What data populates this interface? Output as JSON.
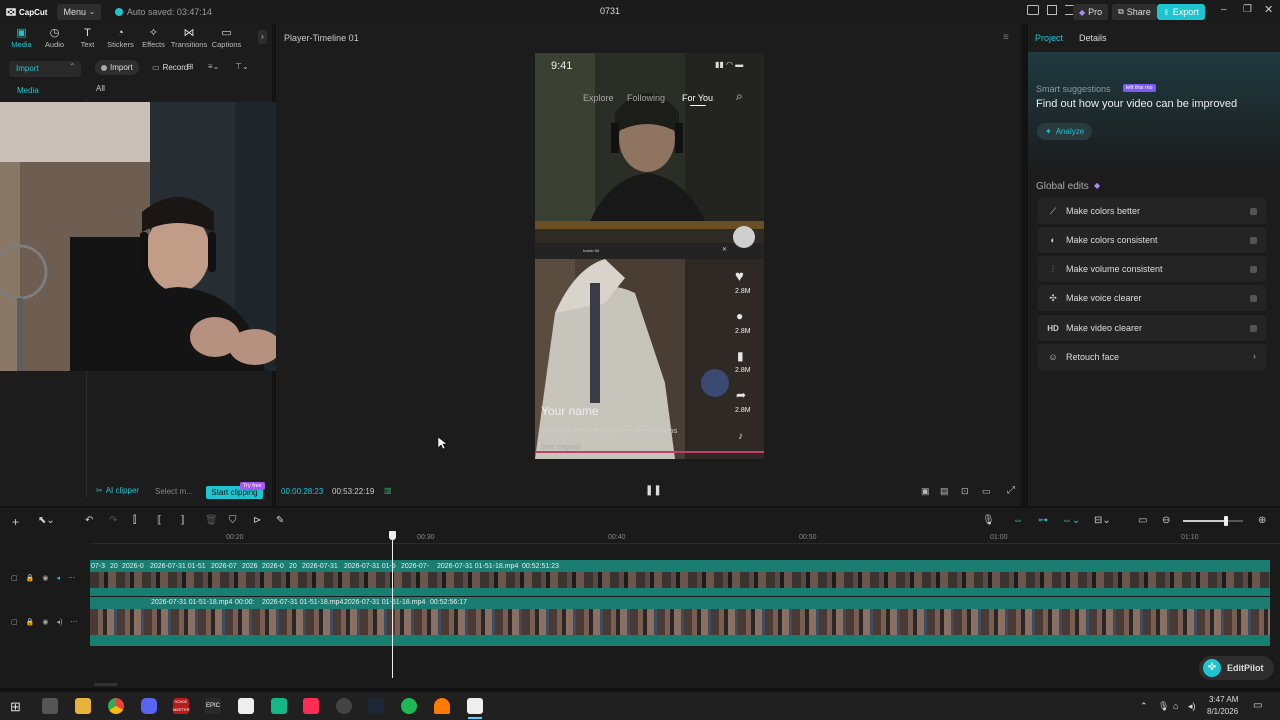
{
  "titlebar": {
    "app_name": "CapCut",
    "menu_label": "Menu",
    "autosave": "Auto saved: 03:47:14",
    "project_title": "0731",
    "pro_label": "Pro",
    "share_label": "Share",
    "export_label": "Export"
  },
  "left": {
    "tabs": [
      {
        "label": "Media",
        "icon": "media-icon"
      },
      {
        "label": "Audio",
        "icon": "audio-icon"
      },
      {
        "label": "Text",
        "icon": "text-icon"
      },
      {
        "label": "Stickers",
        "icon": "stickers-icon"
      },
      {
        "label": "Effects",
        "icon": "effects-icon"
      },
      {
        "label": "Transitions",
        "icon": "transitions-icon"
      },
      {
        "label": "Captions",
        "icon": "captions-icon"
      }
    ],
    "sidebar_import": "Import",
    "sidebar_media": "Media",
    "import_button": "Import",
    "record_button": "Record",
    "filter_all": "All",
    "ai_clipper": "AI clipper",
    "select_placeholder": "Select m...",
    "start_clipping": "Start clipping",
    "try_free": "Try free"
  },
  "player": {
    "title": "Player-Timeline 01",
    "current_time": "00:00:28:23",
    "total_time": "00:53:22:19",
    "phone": {
      "time": "9:41",
      "tabs": [
        "Explore",
        "Following",
        "For You"
      ],
      "username": "Your name",
      "description": "Here are some descriptions about videos",
      "see_original": "See original",
      "like_count": "2.8M",
      "comment_count": "2.8M",
      "save_count": "2.8M",
      "share_count": "2.8M",
      "mini_text": "bulalo 66"
    }
  },
  "right": {
    "tab_project": "Project",
    "tab_details": "Details",
    "smart_title": "Smart suggestions",
    "smart_badge": "left this mo",
    "smart_heading": "Find out how your video can be improved",
    "analyze": "Analyze",
    "global_edits": "Global edits",
    "edits": [
      {
        "label": "Make colors better",
        "icon": "magic-wand-icon"
      },
      {
        "label": "Make colors consistent",
        "icon": "palette-icon"
      },
      {
        "label": "Make volume consistent",
        "icon": "volume-sliders-icon"
      },
      {
        "label": "Make voice clearer",
        "icon": "voice-sparkle-icon"
      },
      {
        "label": "Make video clearer",
        "icon": "hd-icon"
      },
      {
        "label": "Retouch face",
        "icon": "face-retouch-icon"
      }
    ]
  },
  "timeline": {
    "ruler": [
      "00:20",
      "00:30",
      "00:40",
      "00:50",
      "01:00",
      "01:10"
    ],
    "track1_labels": [
      "07-3",
      "20",
      "2026-0",
      "2026-07-31 01-51",
      "2026-07",
      "2026",
      "2026-0",
      "20",
      "2026-07-31",
      "2026-07-31 01-5",
      "2026-07-",
      "2026-07-31 01-51-18.mp4",
      "00:52:51:23"
    ],
    "track2_labels": [
      "2026-07-31 01-51-18.mp4",
      "00:00:",
      "2026-07-31 01-51-18.mp4",
      "2026-07-31 01-51-18.mp4",
      "00:52:56:17"
    ],
    "editpilot": "EditPilot",
    "zoom_level": 0.72
  },
  "taskbar": {
    "time": "3:47 AM",
    "date": "8/1/2026",
    "voice_tile": "VOICE MEETER",
    "epic_tile": "EPIC"
  },
  "colors": {
    "accent": "#1fc4d1",
    "clip_teal": "#1b7d72",
    "panel": "#1c1c1c",
    "cursor": "#ffffff"
  }
}
